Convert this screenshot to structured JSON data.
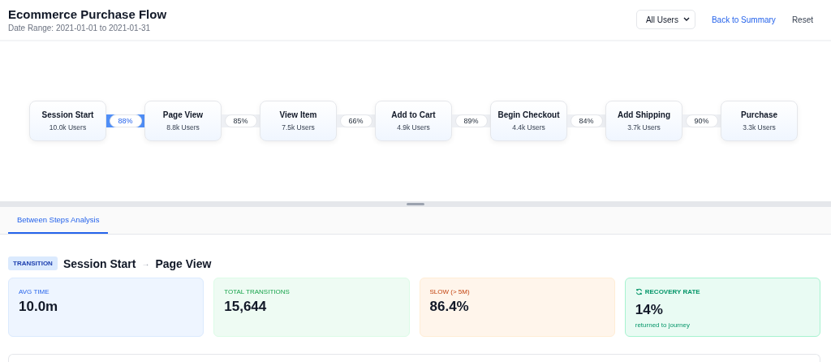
{
  "header": {
    "title": "Ecommerce Purchase Flow",
    "subtitle": "Date Range: 2021-01-01 to 2021-01-31",
    "segment": "All Users",
    "back_link": "Back to Summary",
    "reset": "Reset"
  },
  "steps": [
    {
      "name": "Session Start",
      "users": "10.0k Users"
    },
    {
      "name": "Page View",
      "users": "8.8k Users"
    },
    {
      "name": "View Item",
      "users": "7.5k Users"
    },
    {
      "name": "Add to Cart",
      "users": "4.9k Users"
    },
    {
      "name": "Begin Checkout",
      "users": "4.4k Users"
    },
    {
      "name": "Add Shipping",
      "users": "3.7k Users"
    },
    {
      "name": "Purchase",
      "users": "3.3k Users"
    }
  ],
  "transitions": [
    {
      "rate": "88%",
      "selected": true
    },
    {
      "rate": "85%",
      "selected": false
    },
    {
      "rate": "66%",
      "selected": false
    },
    {
      "rate": "89%",
      "selected": false
    },
    {
      "rate": "84%",
      "selected": false
    },
    {
      "rate": "90%",
      "selected": false
    }
  ],
  "tabs": [
    {
      "label": "Between Steps Analysis",
      "selected": true
    }
  ],
  "transition": {
    "badge": "TRANSITION",
    "from": "Session Start",
    "arrow": "→",
    "to": "Page View"
  },
  "stats": [
    {
      "kind": "blue",
      "label": "AVG TIME",
      "value": "10.0m"
    },
    {
      "kind": "green",
      "label": "TOTAL TRANSITIONS",
      "value": "15,644"
    },
    {
      "kind": "orange",
      "label": "SLOW (> 5M)",
      "value": "86.4%"
    },
    {
      "kind": "teal",
      "label": "RECOVERY RATE",
      "value": "14%",
      "note": "returned to journey"
    }
  ]
}
